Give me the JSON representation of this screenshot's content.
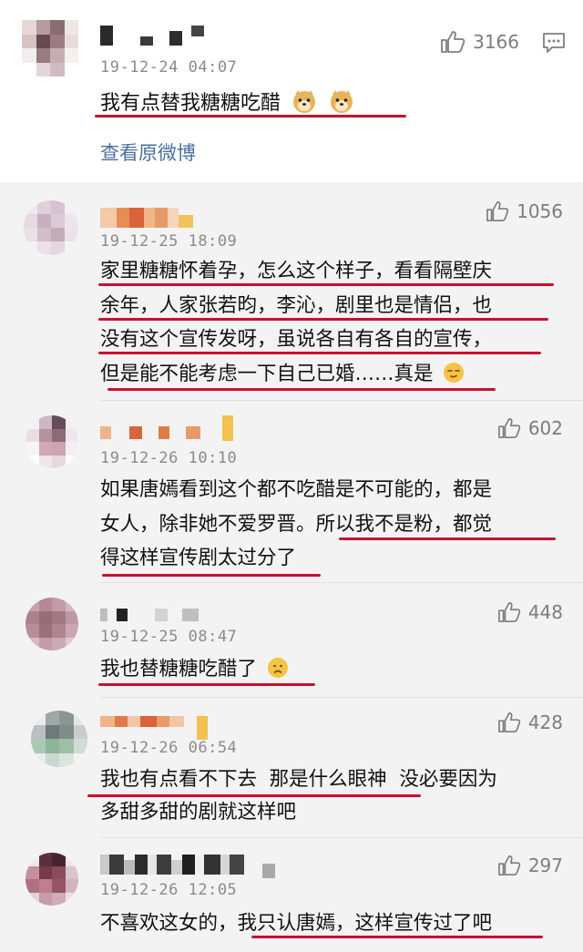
{
  "top_comment": {
    "timestamp": "19-12-24 04:07",
    "likes": "3166",
    "text": "我有点替我糖糖吃醋",
    "emoji": "doge-icon",
    "view_original": "查看原微博"
  },
  "replies": [
    {
      "timestamp": "19-12-25 18:09",
      "likes": "1056",
      "lines": [
        "家里糖糖怀着孕，怎么这个样子，看看隔壁庆",
        "余年，人家张若昀，李沁，剧里也是情侣，也",
        "没有这个宣传发呀，虽说各自有各自的宣传，",
        "但是能不能考虑一下自己已婚……真是"
      ],
      "emoji": "smirk-face-icon"
    },
    {
      "timestamp": "19-12-26 10:10",
      "likes": "602",
      "lines": [
        "如果唐嫣看到这个都不吃醋是不可能的，都是",
        "女人，除非她不爱罗晋。所以我不是粉，都觉",
        "得这样宣传剧太过分了"
      ]
    },
    {
      "timestamp": "19-12-25 08:47",
      "likes": "448",
      "lines": [
        "我也替糖糖吃醋了"
      ],
      "emoji": "sad-face-icon"
    },
    {
      "timestamp": "19-12-26 06:54",
      "likes": "428",
      "lines": [
        "我也有点看不下去  那是什么眼神  没必要因为",
        "多甜多甜的剧就这样吧"
      ]
    },
    {
      "timestamp": "19-12-26 12:05",
      "likes": "297",
      "lines": [
        "不喜欢这女的，我只认唐嫣，这样宣传过了吧"
      ]
    }
  ],
  "colors": {
    "underline": "#c8102e",
    "link": "#4a6fa0",
    "meta": "#8a8a8a"
  }
}
